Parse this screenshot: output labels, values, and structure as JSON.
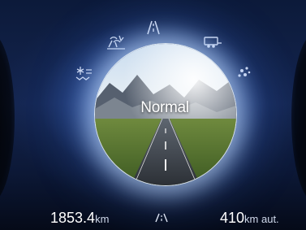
{
  "drive_mode": {
    "selected_label": "Normal",
    "modes": [
      "normal-road",
      "slippery",
      "tow-haul",
      "sport",
      "snow"
    ]
  },
  "trip": {
    "distance_value": "1853.4",
    "distance_unit": "km"
  },
  "range": {
    "value": "410",
    "unit": "km aut."
  },
  "colors": {
    "background": "#14254f",
    "glow": "#b8d4ff",
    "text": "#ffffff"
  }
}
